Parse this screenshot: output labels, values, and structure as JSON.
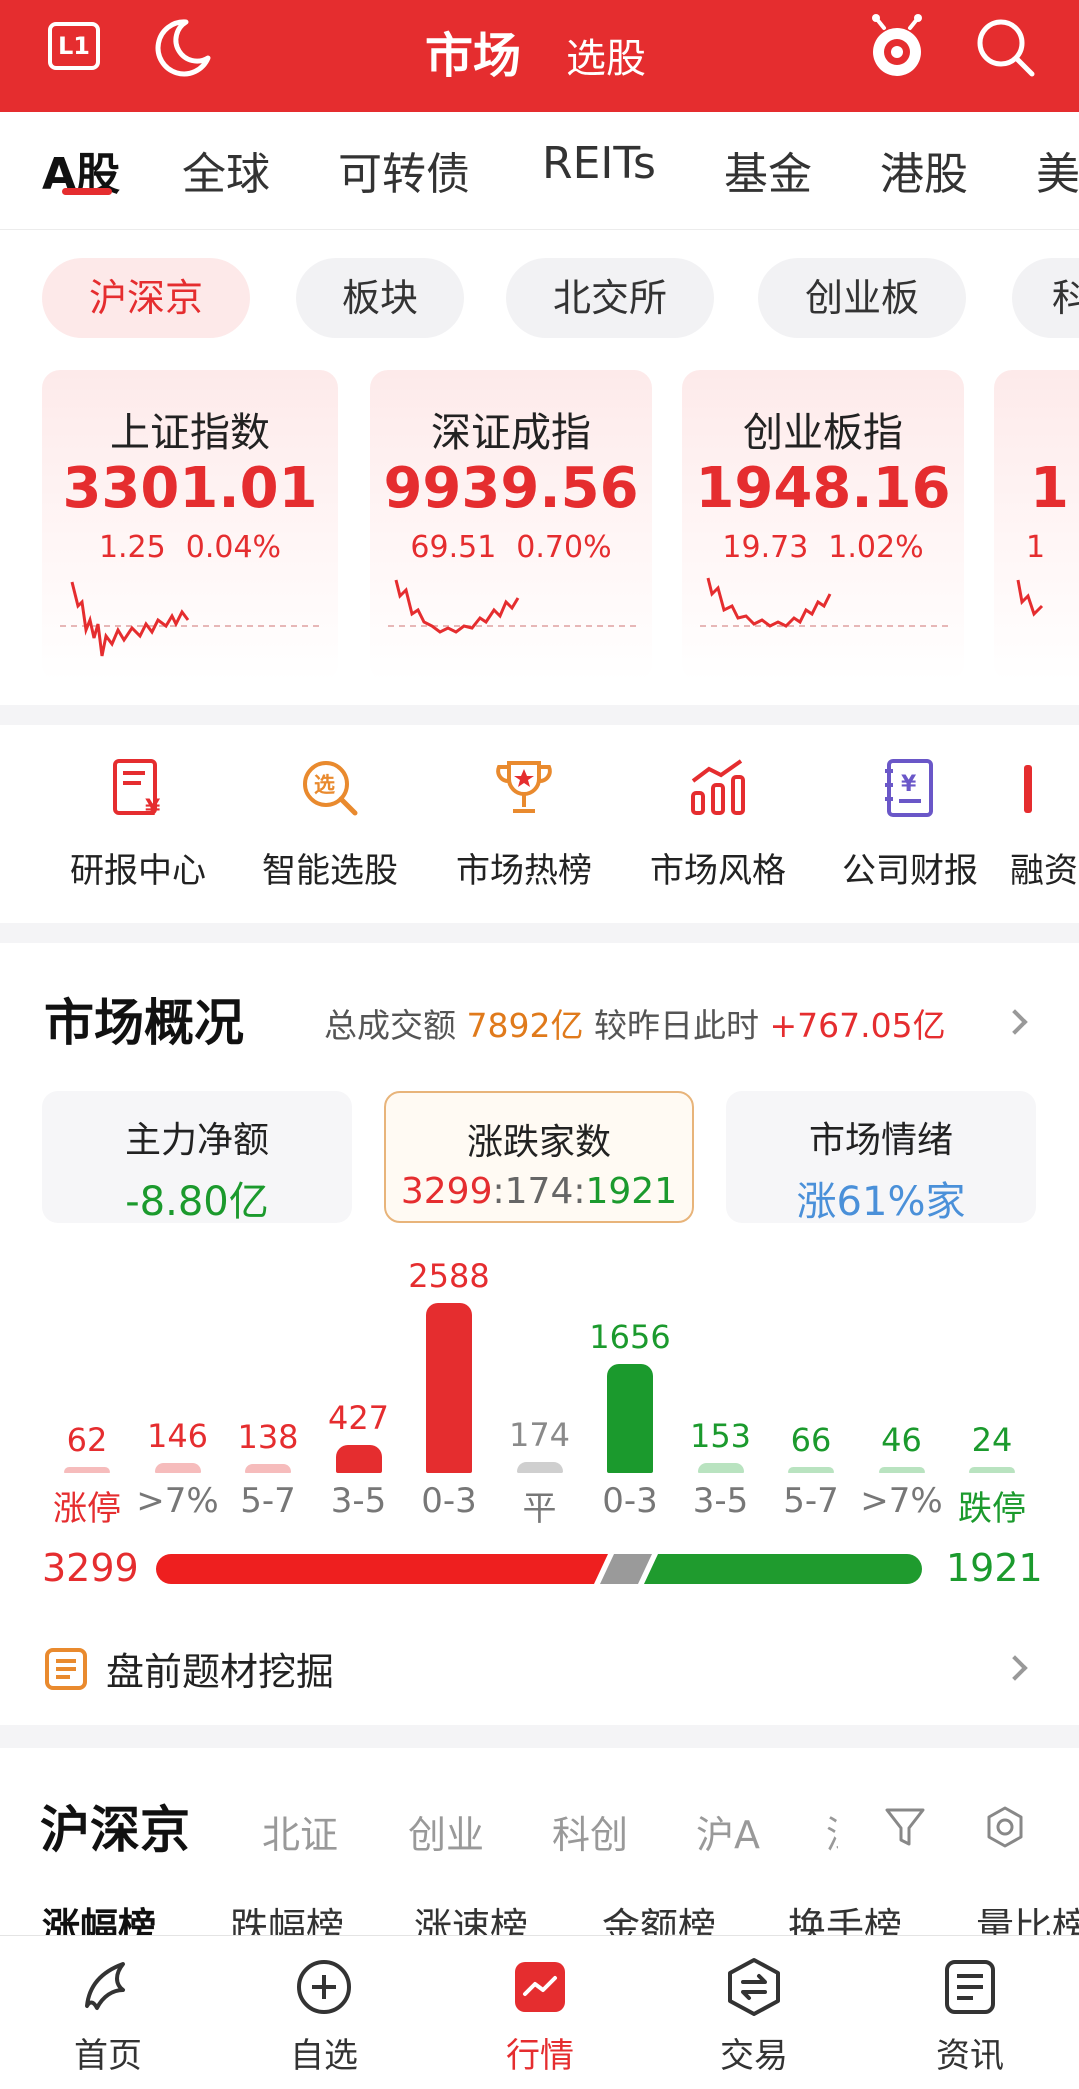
{
  "header": {
    "badge": "L1",
    "title": "市场",
    "subtitle": "选股"
  },
  "tabs": [
    "A股",
    "全球",
    "可转债",
    "REITs",
    "基金",
    "港股",
    "美"
  ],
  "chips": [
    "沪深京",
    "板块",
    "北交所",
    "创业板",
    "科"
  ],
  "indices": [
    {
      "name": "上证指数",
      "value": "3301.01",
      "change": "1.25",
      "pct": "0.04%"
    },
    {
      "name": "深证成指",
      "value": "9939.56",
      "change": "69.51",
      "pct": "0.70%"
    },
    {
      "name": "创业板指",
      "value": "1948.16",
      "change": "19.73",
      "pct": "1.02%"
    },
    {
      "name": "",
      "value": "1",
      "change": "1",
      "pct": ""
    }
  ],
  "tools": [
    "研报中心",
    "智能选股",
    "市场热榜",
    "市场风格",
    "公司财报",
    "融资"
  ],
  "overview": {
    "title": "市场概况",
    "turnover_label": "总成交额",
    "turnover_value": "7892亿",
    "compare_label": "较昨日此时",
    "compare_value": "+767.05亿",
    "stats": [
      {
        "label": "主力净额",
        "value": "-8.80亿"
      },
      {
        "label": "涨跌家数",
        "value_up": "3299",
        "value_flat": "174",
        "value_down": "1921"
      },
      {
        "label": "市场情绪",
        "value": "涨61%家"
      }
    ],
    "distribution": [
      {
        "label": "涨停",
        "count": "62"
      },
      {
        "label": ">7%",
        "count": "146"
      },
      {
        "label": "5-7",
        "count": "138"
      },
      {
        "label": "3-5",
        "count": "427"
      },
      {
        "label": "0-3",
        "count": "2588"
      },
      {
        "label": "平",
        "count": "174"
      },
      {
        "label": "0-3",
        "count": "1656"
      },
      {
        "label": "3-5",
        "count": "153"
      },
      {
        "label": "5-7",
        "count": "66"
      },
      {
        "label": ">7%",
        "count": "46"
      },
      {
        "label": "跌停",
        "count": "24"
      }
    ],
    "up_total": "3299",
    "down_total": "1921",
    "mining_label": "盘前题材挖掘"
  },
  "rank": {
    "title": "沪深京",
    "tabs": [
      "北证",
      "创业",
      "科创",
      "沪A",
      "深"
    ],
    "sub_tabs": [
      "涨幅榜",
      "跌幅榜",
      "涨速榜",
      "金额榜",
      "换手榜",
      "量比榜"
    ]
  },
  "nav": [
    "首页",
    "自选",
    "行情",
    "交易",
    "资讯"
  ],
  "colors": {
    "brand": "#e52d2f",
    "up": "#e52d2f",
    "down": "#1b9a2d",
    "flat": "#8a8a8a",
    "mood": "#4a90d9",
    "highlight": "#e07a1b"
  }
}
